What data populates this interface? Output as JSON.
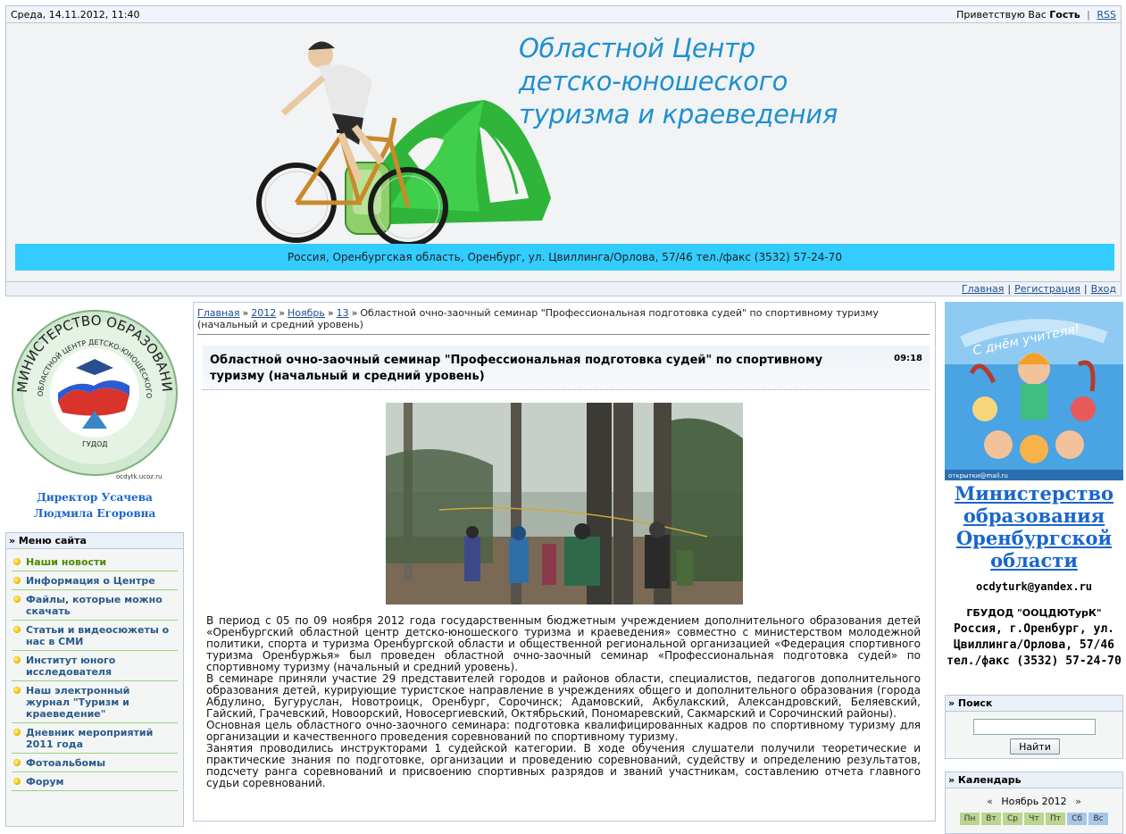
{
  "topbar": {
    "datetime": "Среда, 14.11.2012, 11:40",
    "greeting": "Приветствую Вас",
    "user": "Гость",
    "rss": "RSS"
  },
  "header": {
    "title_line1": "Областной Центр",
    "title_line2": "детско-юношеского",
    "title_line3": "туризма и краеведения",
    "address": "Россия, Оренбургская область, Оренбург, ул. Цвиллинга/Орлова, 57/46 тел./факс (3532) 57-24-70"
  },
  "navbar": {
    "home": "Главная",
    "register": "Регистрация",
    "login": "Вход"
  },
  "left": {
    "logo_text_top": "МИНИСТЕРСТВО ОБРАЗОВАНИЯ ОРЕНБУРГСКОЙ ОБЛАСТИ",
    "logo_text_inner": "ОБЛАСТНОЙ ЦЕНТР ДЕТСКО-ЮНОШЕСКОГО ТУРИЗМА И КРАЕВЕДЕНИЯ",
    "logo_text_bottom": "ГУДОД",
    "logo_url": "ocdytk.ucoz.ru",
    "director_line1": "Директор Усачева",
    "director_line2": "Людмила Егоровна",
    "menu_title": "» Меню сайта",
    "menu": [
      "Наши новости",
      "Информация о Центре",
      "Файлы, которые можно скачать",
      "Статьи и видеосюжеты о нас в СМИ",
      "Институт юного исследователя",
      "Наш электронный журнал \"Туризм и краеведение\"",
      "Дневник мероприятий 2011 года",
      "Фотоальбомы",
      "Форум"
    ]
  },
  "breadcrumb": {
    "home": "Главная",
    "year": "2012",
    "month": "Ноябрь",
    "day": "13",
    "arrow": "»",
    "current": "Областной очно-заочный семинар \"Профессиональная подготовка судей\" по спортивному туризму (начальный и средний уровень)"
  },
  "post": {
    "title": "Областной очно-заочный семинар \"Профессиональная подготовка судей\" по спортивному туризму (начальный и средний уровень)",
    "time": "09:18",
    "paragraphs": [
      "В период с 05 по 09 ноября 2012 года государственным бюджетным учреждением дополнительного образования детей «Оренбургский областной центр детско-юношеского туризма и краеведения» совместно с министерством молодежной политики, спорта и туризма Оренбургской области и общественной региональной организацией «Федерация спортивного туризма Оренбуржья» был проведен областной очно-заочный семинар «Профессиональная подготовка судей» по спортивному туризму (начальный и средний уровень).",
      "В семинаре приняли участие 29 представителей городов и районов области, специалистов, педагогов дополнительного образования детей, курирующие туристское направление в учреждениях общего и дополнительного образования (города Абдулино, Бугуруслан, Новотроицк, Оренбург, Сорочинск; Адамовский, Акбулакский, Александровский, Беляевский, Гайский, Грачевский, Новоорский, Новосергиевский, Октябрьский, Пономаревский, Сакмарский и Сорочинский районы).",
      "Основная цель областного очно-заочного семинара: подготовка квалифицированных кадров по спортивному туризму для организации и качественного проведения соревнований по спортивному туризму.",
      "Занятия проводились инструкторами 1 судейской категории. В ходе обучения слушатели получили теоретические и практические знания по подготовке, организации и проведению соревнований, судейству и определению результатов, подсчету ранга соревнований и присвоению спортивных разрядов и званий участникам, составлению отчета главного судьи соревнований."
    ]
  },
  "right": {
    "banner_text": "С днём учителя!",
    "banner_footer": "открытки@mail.ru",
    "ministry": "Министерство образования Оренбургской области",
    "email": "ocdyturk@yandex.ru",
    "org_name": "ГБУДОД \"ООЦДЮТурК\"",
    "org_addr": "Россия, г.Оренбург, ул. Цвиллинга/Орлова, 57/46 тел./факс (3532) 57-24-70",
    "search_title": "» Поиск",
    "search_button": "Найти",
    "calendar_title": "» Календарь",
    "calendar_month": "Ноябрь 2012",
    "calendar_prev": "«",
    "calendar_next": "»",
    "weekdays": [
      "Пн",
      "Вт",
      "Ср",
      "Чт",
      "Пт",
      "Сб",
      "Вс"
    ]
  },
  "colors": {
    "accent_blue": "#1e8fd1",
    "address_bar": "#33ccff",
    "link": "#1a4f8f",
    "menu_divider": "#9fd27f"
  }
}
